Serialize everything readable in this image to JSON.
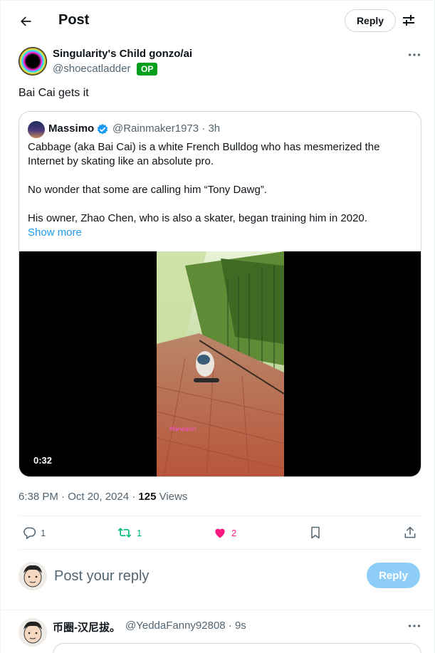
{
  "header": {
    "title": "Post",
    "reply_label": "Reply"
  },
  "post": {
    "author_name": "Singularity's Child gonzo/ai",
    "author_handle": "@shoecatladder",
    "badge": "OP",
    "text": "Bai Cai gets it",
    "timestamp": "6:38 PM · Oct 20, 2024 · ",
    "views_count": "125",
    "views_label": " Views"
  },
  "quote": {
    "author_name": "Massimo",
    "meta": "@Rainmaker1973 · 3h",
    "paragraphs": [
      "Cabbage (aka Bai Cai) is a white French Bulldog who has mesmerized the Internet by skating like an absolute pro.",
      "No wonder that some are calling him “Tony Dawg”.",
      "His owner, Zhao Chen, who is also a skater, began training him in 2020."
    ],
    "show_more": "Show more",
    "video_duration": "0:32"
  },
  "actions": {
    "replies": "1",
    "reposts": "1",
    "likes": "2"
  },
  "composer": {
    "placeholder": "Post your reply",
    "button": "Reply"
  },
  "reply": {
    "author_name": "币圈-汉尼拔。",
    "meta": "@YeddaFanny92808 · 9s"
  },
  "colors": {
    "accent": "#1d9bf0",
    "repost_active": "#00ba7c",
    "like_active": "#f91880",
    "op_badge": "#00a01e"
  }
}
